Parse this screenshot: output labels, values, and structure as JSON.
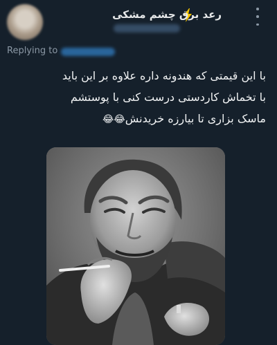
{
  "tweet": {
    "author": {
      "display_name": "رعد برق چشم مشکی",
      "avatar_icon": "blurred-profile-photo",
      "username": ""
    },
    "replying_to_label": "Replying to",
    "replying_to_handle": "",
    "text_lines": [
      "با این قیمتی که هندونه داره علاوه بر این باید",
      "با تخماش کاردستی درست کنی با پوستشم",
      "ماسک بزاری تا بیارزه خریدنش"
    ],
    "emoji": "😂😂",
    "media": {
      "type": "photo",
      "description_icon": "laughing-man-photo",
      "tone": "black-and-white"
    },
    "more_icon": "more-options-icon",
    "name_badge_icon": "lightning-bolt-icon",
    "colors": {
      "background": "#15202b",
      "primary_text": "#e7e9ea",
      "secondary_text": "#8b98a5",
      "link_blue": "#1d9bf0",
      "badge_yellow": "#f5c400"
    }
  }
}
